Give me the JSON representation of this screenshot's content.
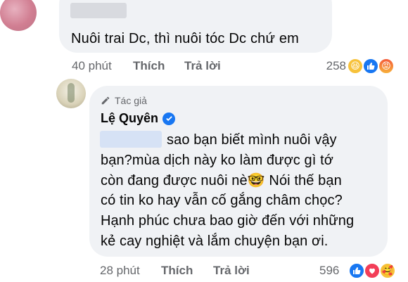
{
  "comment1": {
    "text": "Nuôi trai Dc, thì nuôi tóc Dc chứ em",
    "time": "40 phút",
    "like": "Thích",
    "reply": "Trả lời",
    "reaction_count": "258",
    "reactions": [
      "haha-icon",
      "like-icon",
      "angry-icon"
    ]
  },
  "reply1": {
    "author_tag": "Tác giả",
    "author_name": "Lệ Quyên",
    "lines": [
      "sao bạn biết mình nuôi vậy",
      "bạn?mùa dịch này ko làm được gì tớ",
      "còn đang được nuôi nè🤓 Nói thế bạn",
      "có tin ko hay vẫn cố gắng châm chọc?",
      "Hạnh phúc chưa bao giờ đến với những",
      "kẻ cay nghiệt và lắm chuyện bạn ơi."
    ],
    "time": "28 phút",
    "like": "Thích",
    "reply": "Trả lời",
    "reaction_count": "596",
    "reactions": [
      "like-icon",
      "love-icon",
      "care-icon"
    ]
  },
  "colors": {
    "bubble": "#f0f2f5",
    "meta_text": "#65676b",
    "accent": "#1877f2"
  }
}
